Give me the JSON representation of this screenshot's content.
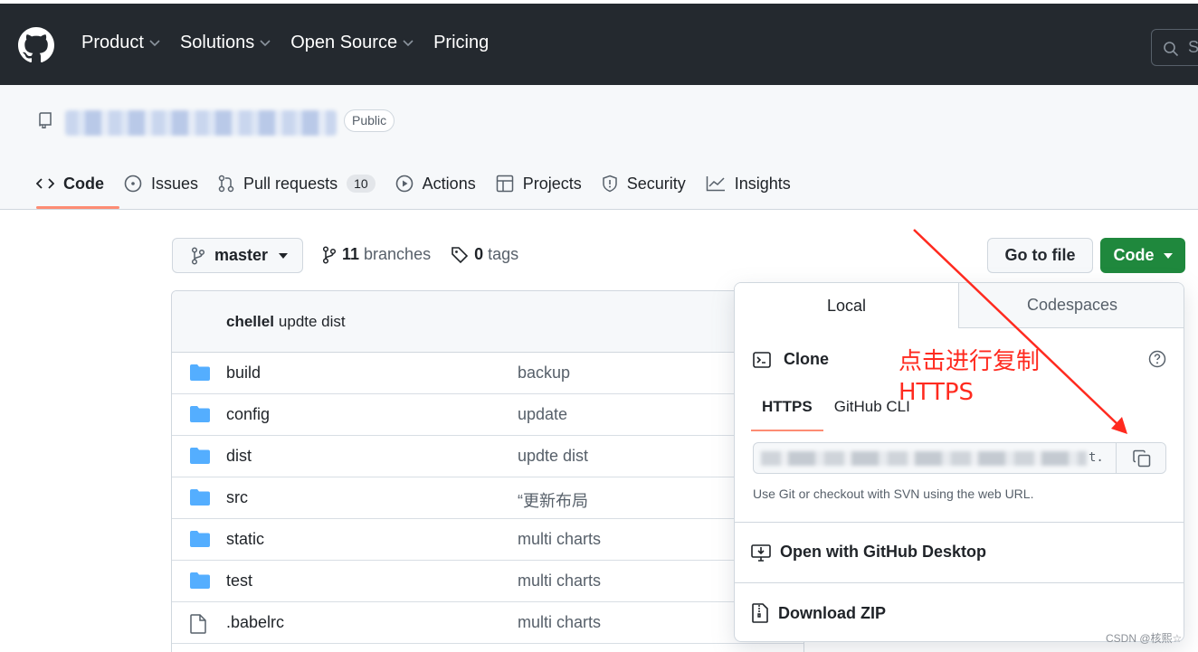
{
  "topnav": {
    "items": [
      "Product",
      "Solutions",
      "Open Source",
      "Pricing"
    ],
    "search_placeholder": "S"
  },
  "repo": {
    "visibility": "Public",
    "tabs": [
      {
        "label": "Code",
        "icon": "code-icon"
      },
      {
        "label": "Issues",
        "icon": "issue-icon"
      },
      {
        "label": "Pull requests",
        "icon": "pull-request-icon",
        "count": "10"
      },
      {
        "label": "Actions",
        "icon": "play-icon"
      },
      {
        "label": "Projects",
        "icon": "table-icon"
      },
      {
        "label": "Security",
        "icon": "shield-icon"
      },
      {
        "label": "Insights",
        "icon": "graph-icon"
      }
    ]
  },
  "branchbar": {
    "branch": "master",
    "branches_count": "11",
    "branches_label": "branches",
    "tags_count": "0",
    "tags_label": "tags",
    "goto_file": "Go to file",
    "code_button": "Code"
  },
  "commit": {
    "author": "chellel",
    "message": "updte dist"
  },
  "files": [
    {
      "name": "build",
      "type": "folder",
      "message": "backup"
    },
    {
      "name": "config",
      "type": "folder",
      "message": "update"
    },
    {
      "name": "dist",
      "type": "folder",
      "message": "updte dist"
    },
    {
      "name": "src",
      "type": "folder",
      "message": "“更新布局"
    },
    {
      "name": "static",
      "type": "folder",
      "message": "multi charts"
    },
    {
      "name": "test",
      "type": "folder",
      "message": "multi charts"
    },
    {
      "name": ".babelrc",
      "type": "file",
      "message": "multi charts"
    }
  ],
  "clone_popover": {
    "tab_local": "Local",
    "tab_codespaces": "Codespaces",
    "clone_title": "Clone",
    "protocol_https": "HTTPS",
    "protocol_cli": "GitHub CLI",
    "url_tail": "t.",
    "url_hint": "Use Git or checkout with SVN using the web URL.",
    "open_desktop": "Open with GitHub Desktop",
    "download_zip": "Download ZIP"
  },
  "annotation": {
    "line1": "点击进行复制",
    "line2": "HTTPS",
    "color": "#ff2a1f"
  },
  "watermark": "CSDN @核熙☆"
}
